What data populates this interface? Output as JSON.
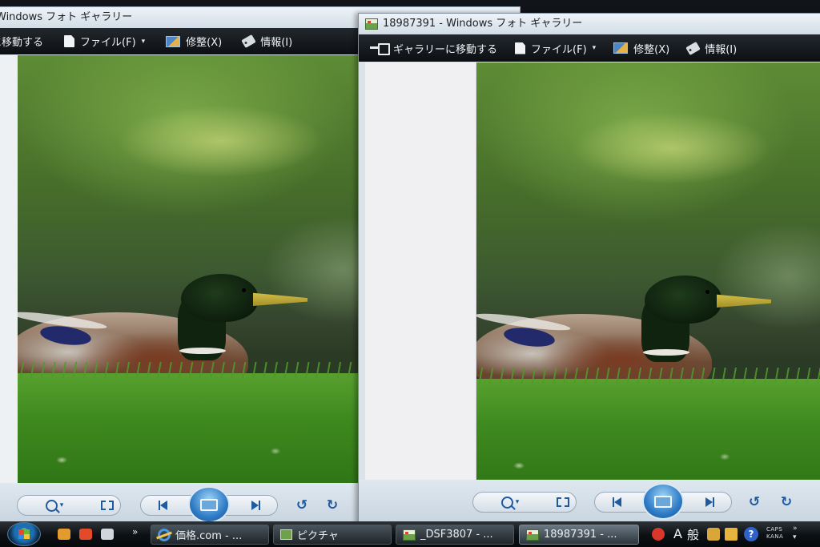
{
  "left_window": {
    "title": "Windows フォト ギャラリー",
    "toolbar": {
      "move": "に移動する",
      "file": "ファイル(F)",
      "fix": "修整(X)",
      "info": "情報(I)"
    }
  },
  "right_window": {
    "title": "18987391 - Windows フォト ギャラリー",
    "toolbar": {
      "move": "ギャラリーに移動する",
      "file": "ファイル(F)",
      "fix": "修整(X)",
      "info": "情報(I)"
    }
  },
  "controls": {
    "zoom_icon": "magnifier-icon",
    "fit_icon": "actual-size-icon",
    "prev_icon": "previous-icon",
    "slideshow_icon": "slideshow-icon",
    "next_icon": "next-icon",
    "rotate_ccw": "↺",
    "rotate_cw": "↻",
    "dropdown": "▾"
  },
  "taskbar": {
    "chevron": "»",
    "buttons": [
      {
        "label": "価格.com - ...",
        "icon": "ie-icon"
      },
      {
        "label": "ピクチャ",
        "icon": "folder-icon"
      },
      {
        "label": "_DSF3807 - ...",
        "icon": "photo-gallery-icon"
      },
      {
        "label": "18987391 - ...",
        "icon": "photo-gallery-icon"
      }
    ],
    "ime_mode": "A",
    "ime_kanji": "般",
    "help": "?",
    "caps": "CAPS",
    "kana": "KANA"
  },
  "colors": {
    "toolbar_bg": "#0c0f12",
    "taskbar_bg": "#070a0c",
    "control_accent": "#1f5aa0"
  }
}
